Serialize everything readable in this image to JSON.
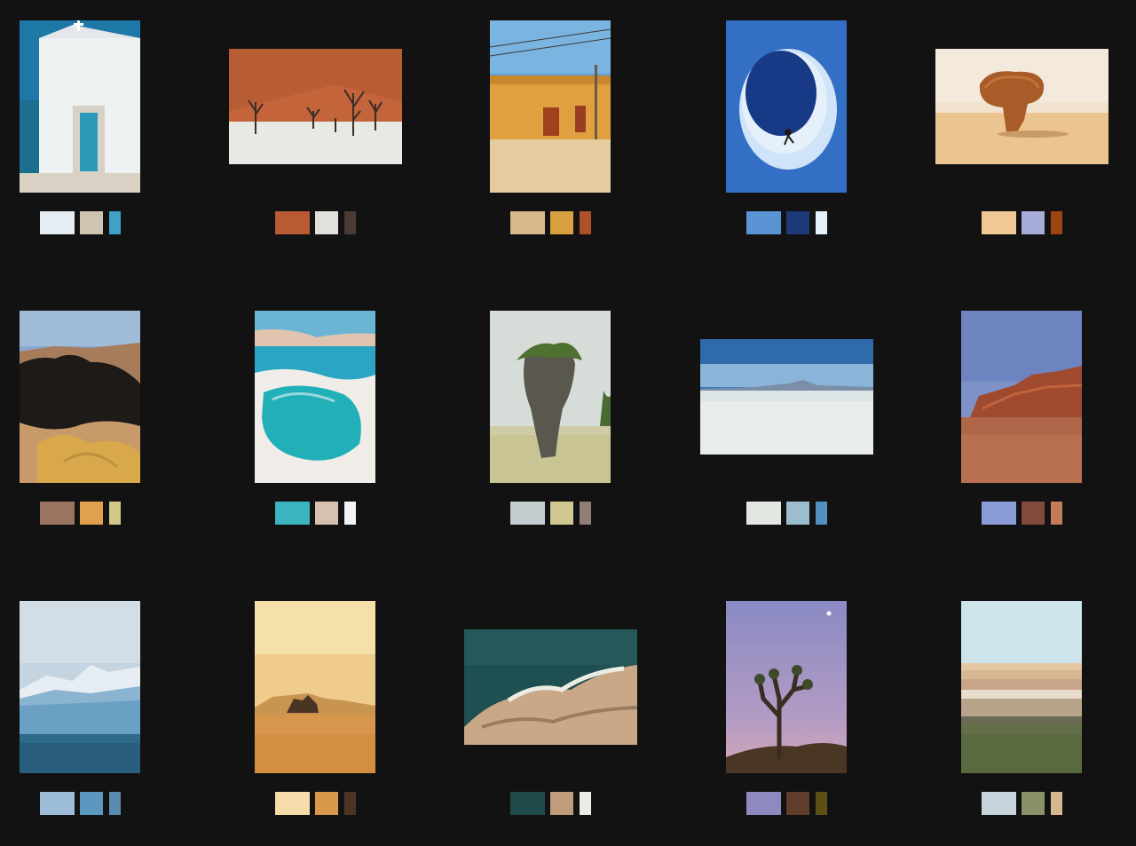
{
  "gallery": {
    "tiles": [
      {
        "subject": "white-chapel-icon",
        "palette": [
          "#e6edf2",
          "#cfc3b2",
          "#3fa0c8"
        ]
      },
      {
        "subject": "dead-trees-dune-icon",
        "palette": [
          "#b85a34",
          "#e0e0dc",
          "#4a3c34"
        ]
      },
      {
        "subject": "yellow-building-icon",
        "palette": [
          "#d8b88a",
          "#d9a040",
          "#b0502a"
        ]
      },
      {
        "subject": "ice-cave-climber-icon",
        "palette": [
          "#5a94d4",
          "#1e3a7a",
          "#e6f0fa"
        ]
      },
      {
        "subject": "rock-formation-desert-icon",
        "palette": [
          "#f0c896",
          "#a8acd8",
          "#a04414"
        ]
      },
      {
        "subject": "volcanic-rock-icon",
        "palette": [
          "#9a7460",
          "#e0a050",
          "#d2c88a"
        ]
      },
      {
        "subject": "turquoise-pool-icon",
        "palette": [
          "#3cb4c0",
          "#d6c0b0",
          "#f4f4f8"
        ]
      },
      {
        "subject": "sea-stack-island-icon",
        "palette": [
          "#c4ccd0",
          "#d0c890",
          "#907e76"
        ]
      },
      {
        "subject": "salt-flat-icon",
        "palette": [
          "#e4e8e2",
          "#9cbcd0",
          "#5290c0"
        ]
      },
      {
        "subject": "red-canyon-icon",
        "palette": [
          "#8a9cd8",
          "#824a3c",
          "#c27c5a"
        ]
      },
      {
        "subject": "glacier-icon",
        "palette": [
          "#9cbcd8",
          "#5a98c0",
          "#5a8cb0"
        ]
      },
      {
        "subject": "hazy-desert-icon",
        "palette": [
          "#f6dcaa",
          "#d8984a",
          "#4c3424"
        ]
      },
      {
        "subject": "coastal-rocks-aerial-icon",
        "palette": [
          "#1e4a4c",
          "#c09c7c",
          "#ecece4"
        ]
      },
      {
        "subject": "joshua-tree-icon",
        "palette": [
          "#8e8ac0",
          "#603e2c",
          "#5c5014"
        ]
      },
      {
        "subject": "layered-landscape-icon",
        "palette": [
          "#c8d4dc",
          "#8a906a",
          "#d6b890"
        ]
      }
    ]
  }
}
